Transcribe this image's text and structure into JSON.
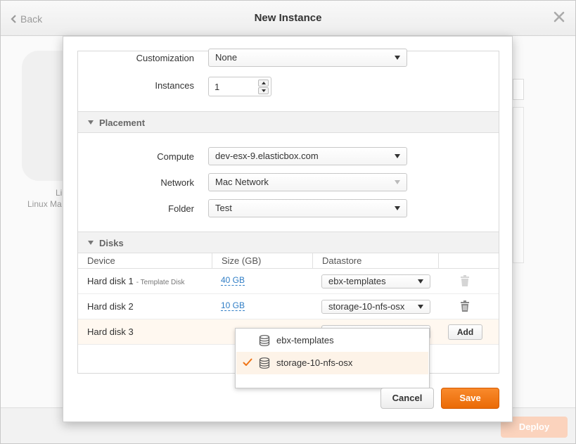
{
  "window": {
    "title": "New Instance",
    "back_label": "Back"
  },
  "background": {
    "card_text_1": "Li",
    "card_text_2": "Linux Ma",
    "deploy_label": "Deploy"
  },
  "form": {
    "customization": {
      "label": "Customization",
      "value": "None"
    },
    "instances": {
      "label": "Instances",
      "value": "1"
    },
    "placement": {
      "title": "Placement",
      "compute": {
        "label": "Compute",
        "value": "dev-esx-9.elasticbox.com"
      },
      "network": {
        "label": "Network",
        "value": "Mac Network"
      },
      "folder": {
        "label": "Folder",
        "value": "Test"
      }
    },
    "disks": {
      "title": "Disks",
      "columns": [
        "Device",
        "Size (GB)",
        "Datastore"
      ],
      "rows": [
        {
          "device": "Hard disk 1",
          "note": "- Template Disk",
          "size": "40 GB",
          "datastore": "ebx-templates"
        },
        {
          "device": "Hard disk 2",
          "note": "",
          "size": "10 GB",
          "datastore": "storage-10-nfs-osx"
        },
        {
          "device": "Hard disk 3",
          "note": "",
          "size": "",
          "datastore": ""
        }
      ],
      "add_label": "Add",
      "datastore_options": [
        {
          "label": "ebx-templates",
          "selected": false
        },
        {
          "label": "storage-10-nfs-osx",
          "selected": true
        }
      ]
    }
  },
  "actions": {
    "cancel_label": "Cancel",
    "save_label": "Save"
  },
  "colors": {
    "accent": "#ef7416",
    "link": "#2f7dc5",
    "deploy_disabled": "#fbd3bd"
  },
  "icons": [
    "chevron-left-icon",
    "close-icon",
    "caret-down-icon",
    "trash-icon",
    "database-icon",
    "checkmark-icon"
  ]
}
